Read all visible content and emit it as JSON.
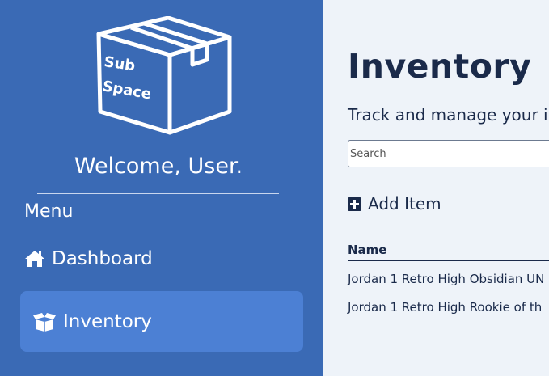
{
  "sidebar": {
    "logo": {
      "line1": "Sub",
      "line2": "Space",
      "icon": "box-icon"
    },
    "welcome": "Welcome, User.",
    "menu_heading": "Menu",
    "items": [
      {
        "label": "Dashboard",
        "icon": "home-icon",
        "active": false
      },
      {
        "label": "Inventory",
        "icon": "open-box-icon",
        "active": true
      }
    ]
  },
  "main": {
    "title": "Inventory",
    "subtitle": "Track and manage your i",
    "search": {
      "placeholder": "Search",
      "value": ""
    },
    "add_item": {
      "label": "Add Item",
      "icon": "plus-square-icon"
    },
    "table": {
      "columns": [
        "Name"
      ],
      "rows": [
        {
          "name": "Jordan 1 Retro High Obsidian UN"
        },
        {
          "name": "Jordan 1 Retro High Rookie of th"
        }
      ]
    }
  },
  "colors": {
    "sidebar_bg": "#3a6ab5",
    "active_item_bg": "#4c80d4",
    "main_bg": "#eef3f9",
    "text_dark": "#1a2a4a"
  }
}
